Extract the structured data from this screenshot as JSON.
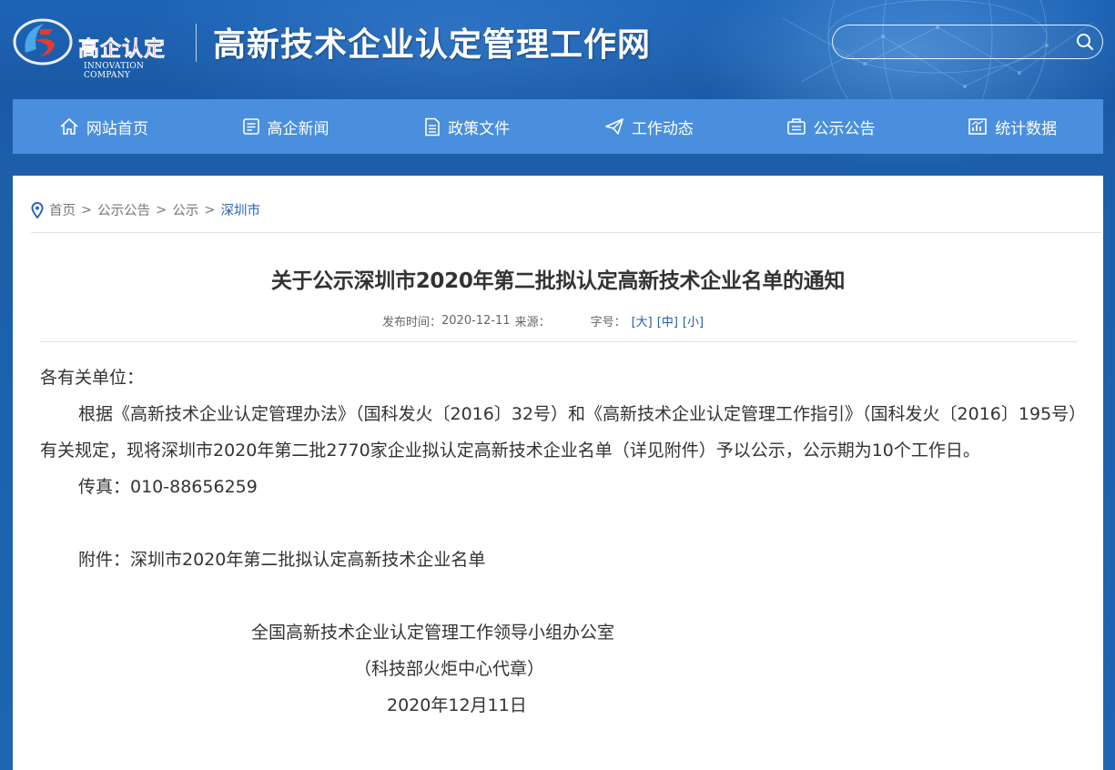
{
  "header": {
    "logo_cn": "高企认定",
    "logo_en": "INNOVATION COMPANY",
    "site_title": "高新技术企业认定管理工作网",
    "search_placeholder": ""
  },
  "nav": [
    {
      "label": "网站首页",
      "icon": "home-icon"
    },
    {
      "label": "高企新闻",
      "icon": "news-icon"
    },
    {
      "label": "政策文件",
      "icon": "document-icon"
    },
    {
      "label": "工作动态",
      "icon": "send-icon"
    },
    {
      "label": "公示公告",
      "icon": "notice-icon"
    },
    {
      "label": "统计数据",
      "icon": "chart-icon"
    }
  ],
  "breadcrumb": {
    "items": [
      "首页",
      "公示公告",
      "公示",
      "深圳市"
    ],
    "separator": ">"
  },
  "article": {
    "title": "关于公示深圳市2020年第二批拟认定高新技术企业名单的通知",
    "meta_publish_label": "发布时间：",
    "meta_publish_date": "2020-12-11",
    "meta_source_label": "来源：",
    "meta_fontsize_label": "字号：",
    "size_large": "[大]",
    "size_medium": "[中]",
    "size_small": "[小]",
    "salutation": "各有关单位：",
    "paragraph1": "根据《高新技术企业认定管理办法》（国科发火〔2016〕32号）和《高新技术企业认定管理工作指引》（国科发火〔2016〕195号）有关规定，现将深圳市2020年第二批2770家企业拟认定高新技术企业名单（详见附件）予以公示，公示期为10个工作日。",
    "fax": "传真：010-88656259",
    "attachment": "附件：深圳市2020年第二批拟认定高新技术企业名单",
    "sign_org": "全国高新技术企业认定管理工作领导小组办公室",
    "sign_note": "（科技部火炬中心代章）",
    "sign_date": "2020年12月11日"
  },
  "colors": {
    "header_bg": "#1c5fa9",
    "nav_bg": "#4a8fde",
    "breadcrumb_current": "#2b67b6",
    "logo_red": "#d8262b"
  }
}
